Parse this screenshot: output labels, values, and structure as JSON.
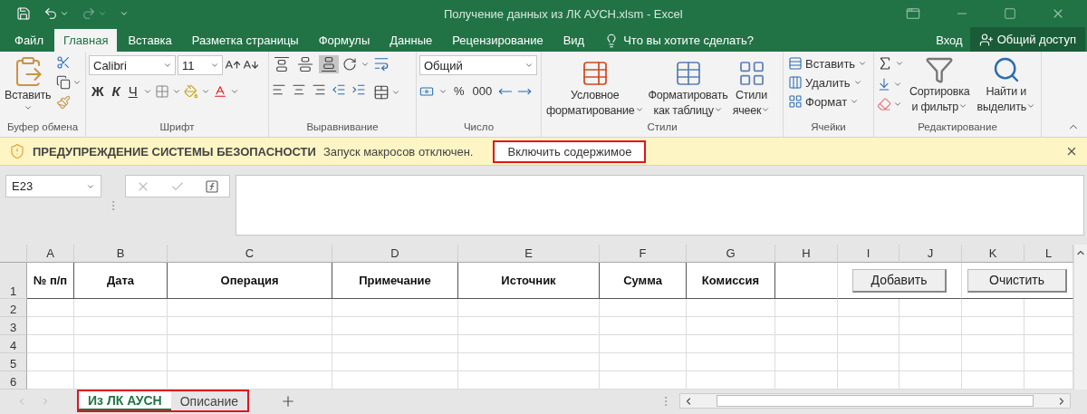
{
  "title_bar": {
    "title": "Получение данных из ЛК АУСН.xlsm - Excel"
  },
  "ribbon_tabs": [
    {
      "label": "Файл",
      "selected": false
    },
    {
      "label": "Главная",
      "selected": true
    },
    {
      "label": "Вставка",
      "selected": false
    },
    {
      "label": "Разметка страницы",
      "selected": false
    },
    {
      "label": "Формулы",
      "selected": false
    },
    {
      "label": "Данные",
      "selected": false
    },
    {
      "label": "Рецензирование",
      "selected": false
    },
    {
      "label": "Вид",
      "selected": false
    }
  ],
  "tell_me": "Что вы хотите сделать?",
  "sign_in": "Вход",
  "share": "Общий доступ",
  "ribbon_groups": [
    {
      "kind": "clipboard",
      "label": "Буфер обмена",
      "paste": "Вставить"
    },
    {
      "kind": "font",
      "label": "Шрифт",
      "font": "Calibri",
      "size": "11",
      "bold": "Ж",
      "italic": "К",
      "underline": "Ч"
    },
    {
      "kind": "alignment",
      "label": "Выравнивание",
      "valign": [
        {
          "selected": false
        },
        {
          "selected": false
        },
        {
          "selected": true
        }
      ]
    },
    {
      "kind": "number",
      "label": "Число",
      "format": "Общий",
      "percent": "%",
      "thousands": "000"
    },
    {
      "kind": "styles",
      "label": "Стили",
      "buttons": [
        {
          "lines": [
            "Условное",
            "форматирование"
          ]
        },
        {
          "lines": [
            "Форматировать",
            "как таблицу"
          ]
        },
        {
          "lines": [
            "Стили",
            "ячеек"
          ]
        }
      ]
    },
    {
      "kind": "cells",
      "label": "Ячейки",
      "buttons": [
        "Вставить",
        "Удалить",
        "Формат"
      ]
    },
    {
      "kind": "editing",
      "label": "Редактирование",
      "buttons": [
        {
          "lines": [
            "Сортировка",
            "и фильтр"
          ]
        },
        {
          "lines": [
            "Найти и",
            "выделить"
          ]
        }
      ]
    }
  ],
  "security_bar": {
    "title": "ПРЕДУПРЕЖДЕНИЕ СИСТЕМЫ БЕЗОПАСНОСТИ",
    "message": "Запуск макросов отключен.",
    "button": "Включить содержимое",
    "button_highlighted": true
  },
  "formula_bar": {
    "name_box": "E23"
  },
  "sheet": {
    "columns": [
      "A",
      "B",
      "C",
      "D",
      "E",
      "F",
      "G",
      "H",
      "I",
      "J",
      "K",
      "L"
    ],
    "rows": [
      "1",
      "2",
      "3",
      "4",
      "5",
      "6"
    ],
    "header_cells": [
      "№ п/п",
      "Дата",
      "Операция",
      "Примечание",
      "Источник",
      "Сумма",
      "Комиссия"
    ],
    "buttons": [
      "Добавить",
      "Очистить"
    ]
  },
  "sheet_tabs": {
    "highlighted": true,
    "tabs": [
      {
        "label": "Из ЛК АУСН",
        "selected": true
      },
      {
        "label": "Описание",
        "selected": false
      }
    ]
  }
}
